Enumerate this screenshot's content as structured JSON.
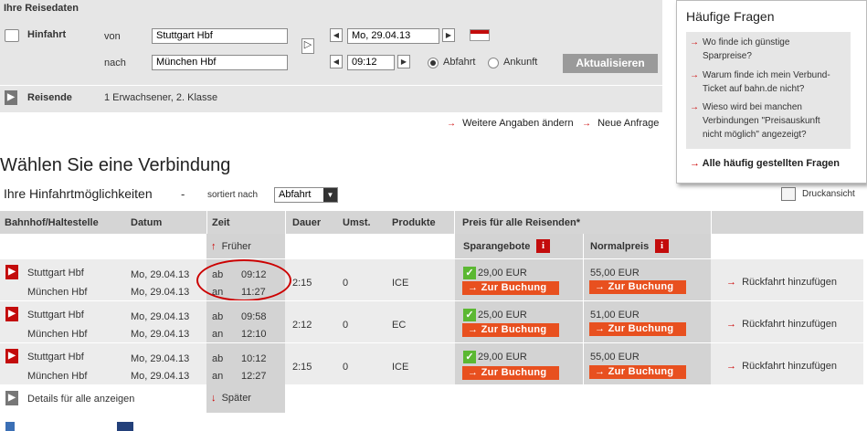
{
  "reisedaten": {
    "title": "Ihre Reisedaten",
    "hinfahrt_label": "Hinfahrt",
    "von_label": "von",
    "nach_label": "nach",
    "von_value": "Stuttgart Hbf",
    "nach_value": "München Hbf",
    "date_value": "Mo, 29.04.13",
    "time_value": "09:12",
    "abfahrt_label": "Abfahrt",
    "ankunft_label": "Ankunft",
    "update_label": "Aktualisieren",
    "reisende_label": "Reisende",
    "reisende_value": "1 Erwachsener, 2. Klasse",
    "weitere_label": "Weitere Angaben ändern",
    "neue_label": "Neue Anfrage",
    "prev_arrow": "◀",
    "next_arrow": "▶",
    "swap_arrow": "▷",
    "link_arrow": "→"
  },
  "faq": {
    "title": "Häufige Fragen",
    "items": [
      {
        "l1": "Wo finde ich günstige",
        "l2": "Sparpreise?",
        "l3": ""
      },
      {
        "l1": "Warum finde ich mein Verbund-",
        "l2": "Ticket auf bahn.de nicht?",
        "l3": ""
      },
      {
        "l1": "Wieso wird bei manchen",
        "l2": "Verbindungen \"Preisauskunft",
        "l3": "nicht möglich\" angezeigt?"
      }
    ],
    "all_label": "Alle häufig gestellten Fragen",
    "arrow": "→"
  },
  "main": {
    "heading": "Wählen Sie eine Verbindung",
    "sub_heading": "Ihre Hinfahrtmöglichkeiten",
    "dash": "-",
    "sort_label": "sortiert nach",
    "sort_value": "Abfahrt",
    "print_label": "Druckansicht"
  },
  "table": {
    "headers": {
      "station": "Bahnhof/Haltestelle",
      "datum": "Datum",
      "zeit": "Zeit",
      "dauer": "Dauer",
      "umst": "Umst.",
      "produkte": "Produkte",
      "preis": "Preis für alle Reisenden*",
      "spar": "Sparangebote",
      "normal": "Normalpreis"
    },
    "earlier": "Früher",
    "later": "Später",
    "up_arrow": "↑",
    "down_arrow": "↓",
    "details_all": "Details für alle anzeigen",
    "book_label": "→ Zur Buchung",
    "return_label": "Rückfahrt hinzufügen",
    "ab": "ab",
    "an": "an",
    "rows": [
      {
        "from": "Stuttgart Hbf",
        "to": "München Hbf",
        "date1": "Mo, 29.04.13",
        "date2": "Mo, 29.04.13",
        "dep": "09:12",
        "arr": "11:27",
        "dauer": "2:15",
        "umst": "0",
        "prod": "ICE",
        "spar": "29,00 EUR",
        "normal": "55,00 EUR"
      },
      {
        "from": "Stuttgart Hbf",
        "to": "München Hbf",
        "date1": "Mo, 29.04.13",
        "date2": "Mo, 29.04.13",
        "dep": "09:58",
        "arr": "12:10",
        "dauer": "2:12",
        "umst": "0",
        "prod": "EC",
        "spar": "25,00 EUR",
        "normal": "51,00 EUR"
      },
      {
        "from": "Stuttgart Hbf",
        "to": "München Hbf",
        "date1": "Mo, 29.04.13",
        "date2": "Mo, 29.04.13",
        "dep": "10:12",
        "arr": "12:27",
        "dauer": "2:15",
        "umst": "0",
        "prod": "ICE",
        "spar": "29,00 EUR",
        "normal": "55,00 EUR"
      }
    ]
  },
  "colors": {
    "accent": "#e8501f",
    "brand_red": "#c30c0c",
    "panel": "#e6e6e6",
    "check_green": "#5bb832"
  }
}
